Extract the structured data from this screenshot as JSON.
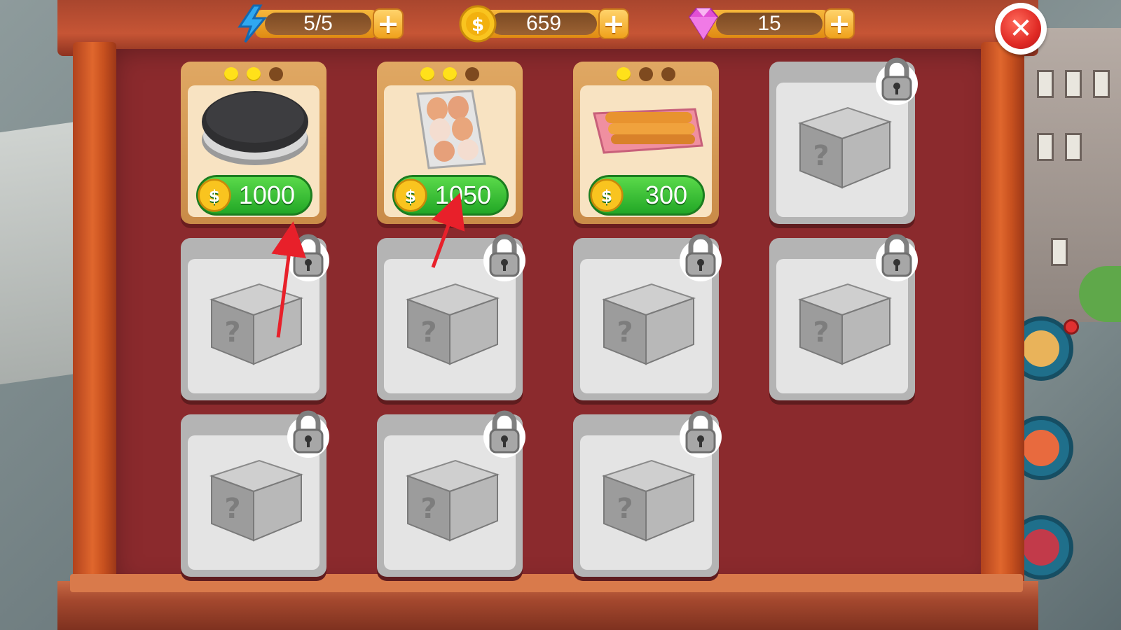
{
  "resources": {
    "energy": {
      "value": "5/5",
      "icon": "lightning-icon"
    },
    "coins": {
      "value": "659",
      "icon": "coin-icon"
    },
    "gems": {
      "value": "15",
      "icon": "gem-icon"
    },
    "plus_label": "+"
  },
  "close_button": {
    "icon": "close-icon",
    "glyph": "✕"
  },
  "cards": [
    {
      "item": "griddle-plate",
      "price": "1000",
      "stars_on": 2,
      "stars_total": 3,
      "locked": false
    },
    {
      "item": "egg-tray",
      "price": "1050",
      "stars_on": 2,
      "stars_total": 3,
      "locked": false
    },
    {
      "item": "fried-dough-sticks",
      "price": "300",
      "stars_on": 1,
      "stars_total": 3,
      "locked": false
    },
    {
      "item": "mystery-box",
      "locked": true
    },
    {
      "item": "mystery-box",
      "locked": true
    },
    {
      "item": "mystery-box",
      "locked": true
    },
    {
      "item": "mystery-box",
      "locked": true
    },
    {
      "item": "mystery-box",
      "locked": true
    },
    {
      "item": "mystery-box",
      "locked": true
    },
    {
      "item": "mystery-box",
      "locked": true
    },
    {
      "item": "mystery-box",
      "locked": true
    }
  ],
  "colors": {
    "panel": "#8b2a2d",
    "frame": "#c65535",
    "price_green": "#22a726",
    "star_on": "#ffe11a",
    "annotation": "#e8202a"
  }
}
